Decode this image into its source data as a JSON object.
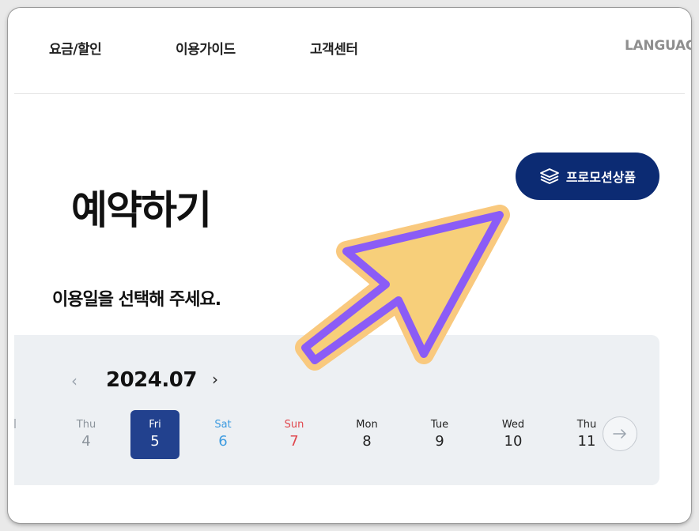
{
  "nav": {
    "items": [
      {
        "label": "요금/할인"
      },
      {
        "label": "이용가이드"
      },
      {
        "label": "고객센터"
      }
    ],
    "language": "LANGUAGE"
  },
  "promo": {
    "label": "프로모션상품",
    "icon": "layers-icon"
  },
  "page": {
    "title": "예약하기",
    "subtitle": "이용일을 선택해 주세요."
  },
  "calendar": {
    "month": "2024.07",
    "prev_icon": "chevron-left-icon",
    "next_icon": "chevron-right-icon",
    "days": [
      {
        "dow": "Thu",
        "num": "4"
      },
      {
        "dow": "Fri",
        "num": "5",
        "selected": true
      },
      {
        "dow": "Sat",
        "num": "6"
      },
      {
        "dow": "Sun",
        "num": "7"
      },
      {
        "dow": "Mon",
        "num": "8"
      },
      {
        "dow": "Tue",
        "num": "9"
      },
      {
        "dow": "Wed",
        "num": "10"
      },
      {
        "dow": "Thu",
        "num": "11"
      }
    ],
    "next_week_icon": "arrow-right-icon"
  },
  "colors": {
    "brand": "#0c2b73",
    "selected": "#22418e",
    "saturday": "#3d9be0",
    "sunday": "#e0464c",
    "weekday_past": "#8b939b",
    "annotation_fill": "#f7cf7a",
    "annotation_stroke": "#8b5cf6"
  }
}
